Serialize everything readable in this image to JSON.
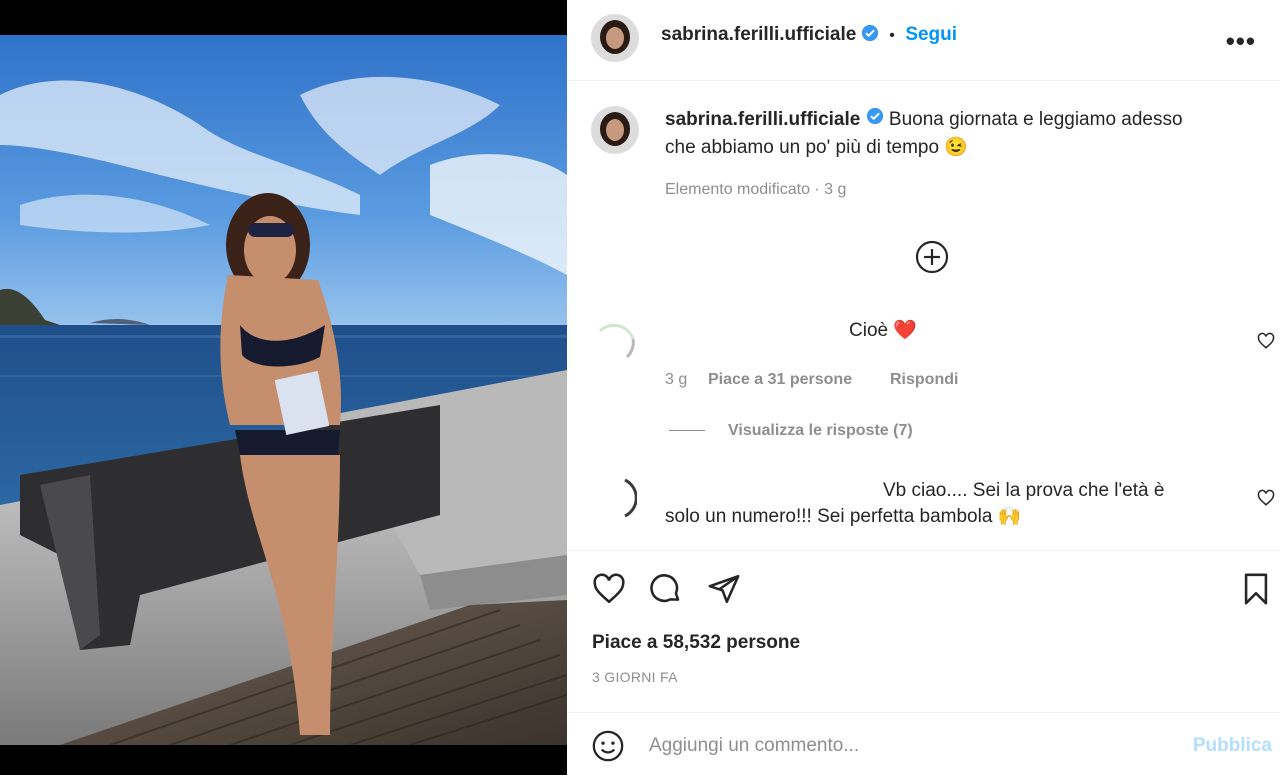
{
  "post": {
    "username": "sabrina.ferilli.ufficiale",
    "follow_label": "Segui",
    "more_label": "•••",
    "separator": "•"
  },
  "caption": {
    "username": "sabrina.ferilli.ufficiale",
    "text_line1": "Buona giornata e leggiamo adesso",
    "text_line2": "che abbiamo un po' più di tempo 😉",
    "meta": "Elemento modificato · 3 g"
  },
  "comments": [
    {
      "text": "Cioè ❤️",
      "time": "3 g",
      "likes": "Piace a 31 persone",
      "reply": "Rispondi",
      "view_replies": "Visualizza le risposte (7)"
    },
    {
      "text_line1": "Vb ciao.... Sei la prova che l'età è",
      "text_line2": "solo un numero!!! Sei perfetta bambola 🙌"
    }
  ],
  "footer": {
    "likes": "Piace a 58,532 persone",
    "date": "3 GIORNI FA",
    "add_comment_placeholder": "Aggiungi un commento...",
    "publish_label": "Pubblica"
  },
  "icons": {
    "verified": "verified-badge-icon",
    "add": "plus-circle-icon",
    "like": "heart-icon",
    "comment": "speech-bubble-icon",
    "share": "paper-plane-icon",
    "save": "bookmark-icon",
    "emoji": "smiley-icon"
  },
  "colors": {
    "accent": "#0095f6",
    "verified": "#3897f0",
    "muted": "#8e8e8e",
    "text": "#262626",
    "publish_disabled": "#b2dffc",
    "heart": "#e0245e"
  }
}
